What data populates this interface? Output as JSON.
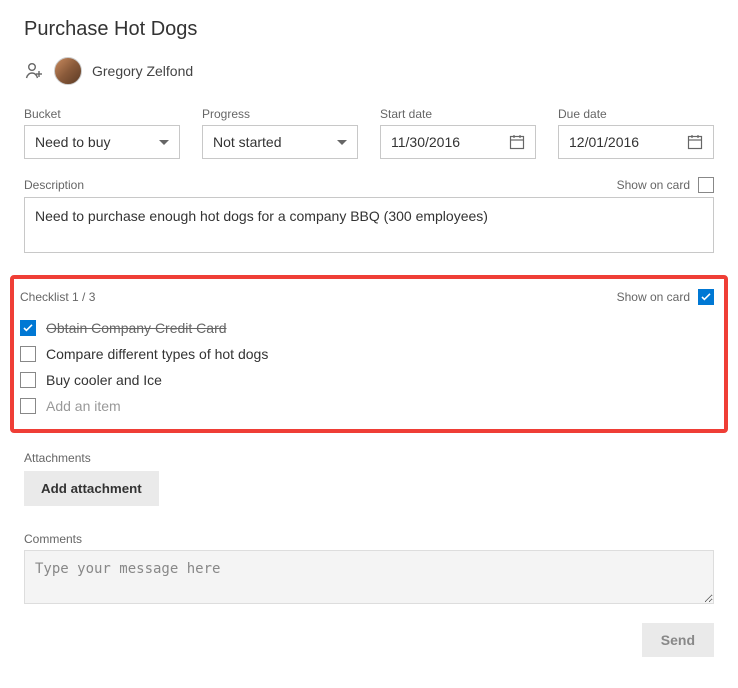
{
  "task": {
    "title": "Purchase Hot Dogs",
    "assignee_name": "Gregory Zelfond"
  },
  "fields": {
    "bucket_label": "Bucket",
    "bucket_value": "Need to buy",
    "progress_label": "Progress",
    "progress_value": "Not started",
    "start_label": "Start date",
    "start_value": "11/30/2016",
    "due_label": "Due date",
    "due_value": "12/01/2016"
  },
  "description": {
    "label": "Description",
    "show_on_card_label": "Show on card",
    "value": "Need to purchase enough hot dogs for a company BBQ (300 employees)"
  },
  "checklist": {
    "label": "Checklist 1 / 3",
    "show_on_card_label": "Show on card",
    "items": [
      {
        "text": "Obtain Company Credit Card"
      },
      {
        "text": "Compare different types of hot dogs"
      },
      {
        "text": "Buy cooler and Ice"
      }
    ],
    "add_placeholder": "Add an item"
  },
  "attachments": {
    "label": "Attachments",
    "button": "Add attachment"
  },
  "comments": {
    "label": "Comments",
    "placeholder": "Type your message here",
    "send": "Send"
  }
}
